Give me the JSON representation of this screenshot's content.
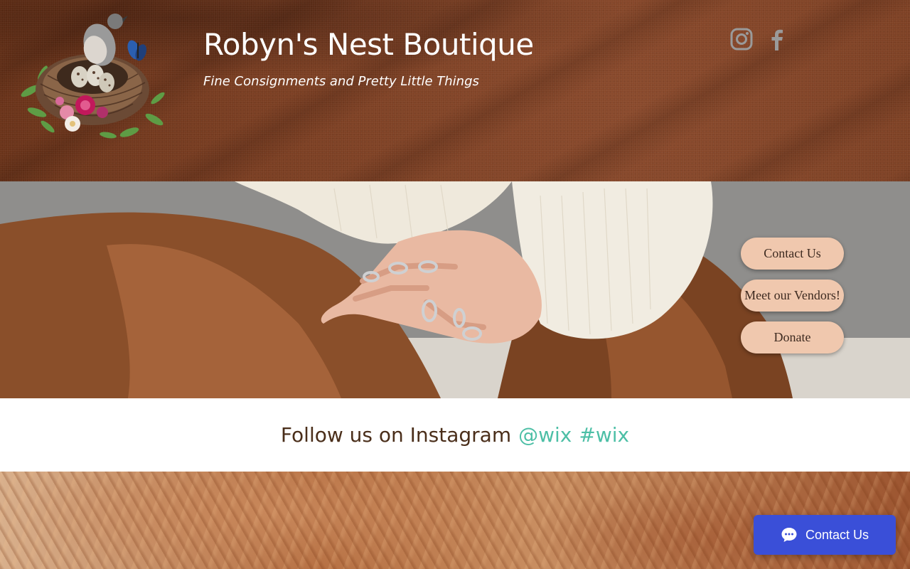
{
  "header": {
    "title": "Robyn's Nest Boutique",
    "tagline": "Fine Consignments and Pretty Little Things",
    "logo_icon": "bird-nest-logo",
    "social": [
      {
        "name": "instagram-icon",
        "color": "#9a9a9a"
      },
      {
        "name": "facebook-icon",
        "color": "#9a9a9a"
      }
    ]
  },
  "hero": {
    "buttons": [
      {
        "label": "Contact Us"
      },
      {
        "label": "Meet our Vendors!"
      },
      {
        "label": "Donate"
      }
    ]
  },
  "follow": {
    "text": "Follow us on Instagram",
    "handle": "@wix",
    "hashtag": "#wix"
  },
  "chat": {
    "label": "Contact Us",
    "icon": "chat-bubble-icon"
  },
  "colors": {
    "header_bg": "#7a3e22",
    "button_bg": "#f0c8ae",
    "link": "#4dbfa6",
    "chat_bg": "#3a4fd8",
    "follow_text": "#4a2e1a"
  }
}
